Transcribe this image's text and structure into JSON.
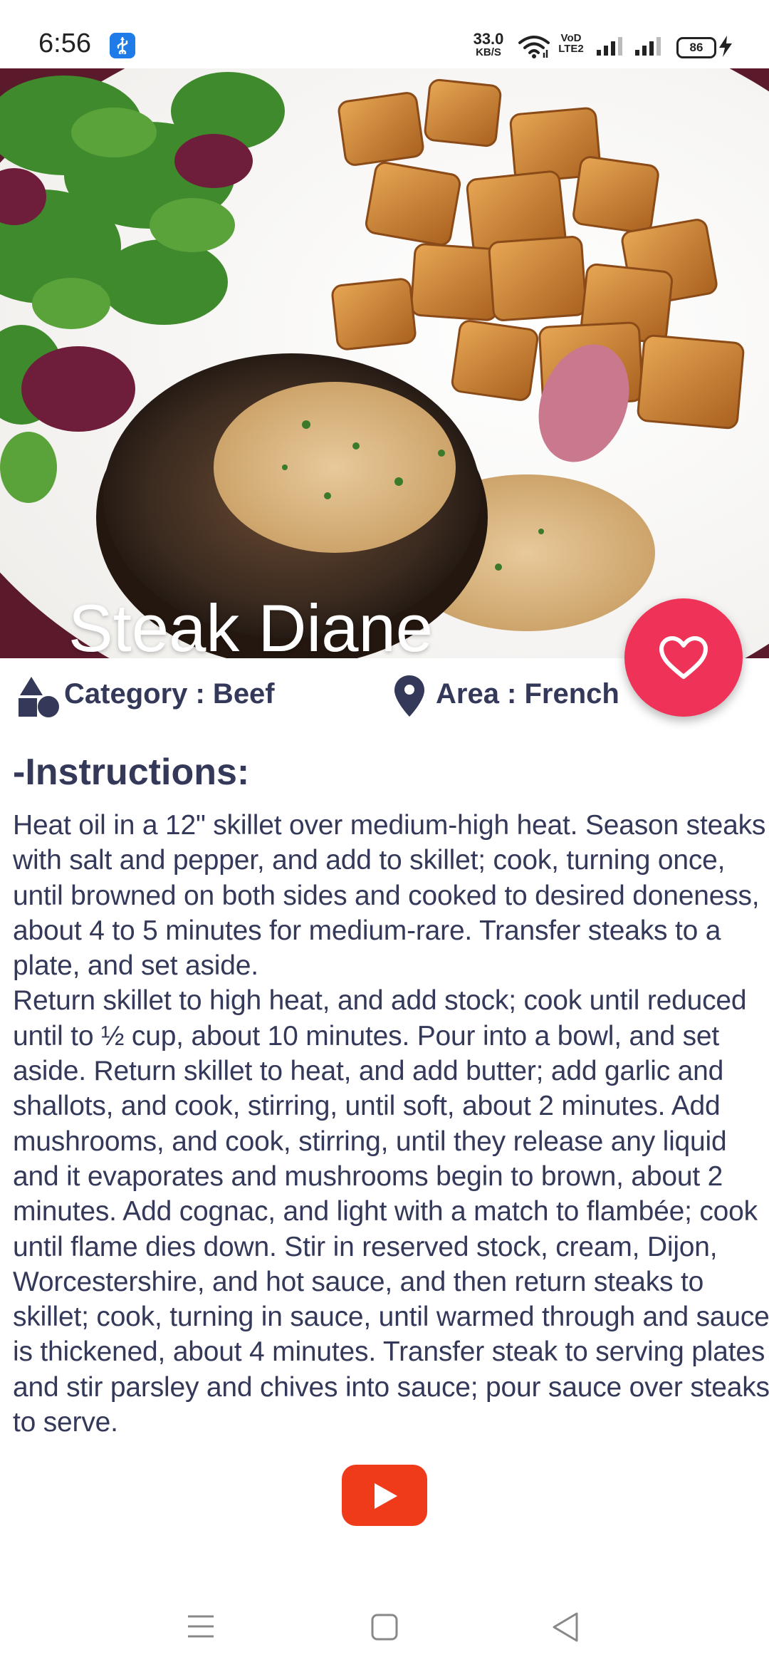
{
  "status_bar": {
    "time": "6:56",
    "net_speed_value": "33.0",
    "net_speed_unit": "KB/S",
    "volte_label_top": "VoD",
    "volte_label_bottom": "LTE2",
    "battery_level": "86"
  },
  "recipe": {
    "title": "Steak Diane",
    "category": "Category : Beef",
    "area": "Area : French",
    "instructions_heading": "-Instructions:",
    "instructions": "Heat oil in a 12\" skillet over medium-high heat. Season steaks with salt and pepper, and add to skillet; cook, turning once, until browned on both sides and cooked to desired doneness, about 4 to 5 minutes for medium-rare. Transfer steaks to a plate, and set aside.\nReturn skillet to high heat, and add stock; cook until reduced until to ½ cup, about 10 minutes. Pour into a bowl, and set aside. Return skillet to heat, and add butter; add garlic and shallots, and cook, stirring, until soft, about 2 minutes. Add mushrooms, and cook, stirring, until they release any liquid and it evaporates and mushrooms begin to brown, about 2 minutes. Add cognac, and light with a match to flambée; cook until flame dies down. Stir in reserved stock, cream, Dijon, Worcestershire, and hot sauce, and then return steaks to skillet; cook, turning in sauce, until warmed through and sauce is thickened, about 4 minutes. Transfer steak to serving plates and stir parsley and chives into sauce; pour sauce over steaks to serve."
  },
  "colors": {
    "accent": "#ef3358",
    "text": "#34395a",
    "youtube": "#f03b1b"
  },
  "icons": {
    "usb": "usb-icon",
    "wifi": "wifi-icon",
    "signal": "signal-icon",
    "charging": "charging-bolt-icon",
    "favorite": "heart-icon",
    "category": "shapes-icon",
    "area": "location-pin-icon",
    "video": "youtube-play-icon",
    "nav_menu": "menu-icon",
    "nav_home": "home-square-icon",
    "nav_back": "back-triangle-icon"
  }
}
